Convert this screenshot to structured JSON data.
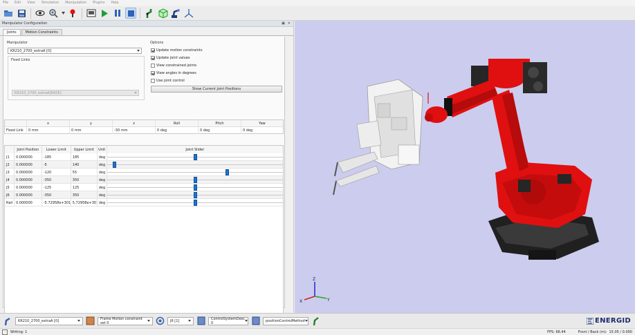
{
  "menu": [
    "File",
    "Edit",
    "View",
    "Simulation",
    "Manipulation",
    "Plugins",
    "Help"
  ],
  "panel": {
    "title": "Manipulator Configuration",
    "tabs": [
      "Joints",
      "Motion Constraints"
    ]
  },
  "manipulator": {
    "group_label": "Manipulator",
    "selected": "KR210_2700_extraA [0]",
    "fixed_links_label": "Fixed Links",
    "fixed_links_value": "KR210_2700_extraA[BASE]"
  },
  "options": {
    "group_label": "Options",
    "items": [
      {
        "label": "Update motion constraints",
        "checked": true
      },
      {
        "label": "Update joint values",
        "checked": true
      },
      {
        "label": "View constrained joints",
        "checked": false
      },
      {
        "label": "View angles in degrees",
        "checked": true
      },
      {
        "label": "Use joint control",
        "checked": false
      }
    ],
    "button": "Show Current Joint Positions"
  },
  "fixed_link_table": {
    "headers": [
      "",
      "x",
      "y",
      "z",
      "Roll",
      "Pitch",
      "Yaw"
    ],
    "row": [
      "Fixed Link",
      "0 mm",
      "0 mm",
      "-30 mm",
      "0 deg",
      "0 deg",
      "0 deg"
    ]
  },
  "joint_table": {
    "headers": [
      "",
      "Joint Position",
      "Lower Limit",
      "Upper Limit",
      "Unit",
      "Joint Slider"
    ],
    "rows": [
      {
        "name": "J1",
        "position": "0.000000",
        "lower": "-185",
        "upper": "185",
        "unit": "deg",
        "slider": 0.5
      },
      {
        "name": "J2",
        "position": "0.000000",
        "lower": "-5",
        "upper": "140",
        "unit": "deg",
        "slider": 0.034
      },
      {
        "name": "J3",
        "position": "0.000000",
        "lower": "-120",
        "upper": "55",
        "unit": "deg",
        "slider": 0.686
      },
      {
        "name": "J4",
        "position": "0.000000",
        "lower": "-350",
        "upper": "350",
        "unit": "deg",
        "slider": 0.5
      },
      {
        "name": "J5",
        "position": "0.000000",
        "lower": "-125",
        "upper": "125",
        "unit": "deg",
        "slider": 0.5
      },
      {
        "name": "J6",
        "position": "0.000000",
        "lower": "-350",
        "upper": "350",
        "unit": "deg",
        "slider": 0.5
      },
      {
        "name": "Rail",
        "position": "0.000000",
        "lower": "-5.72958e+301",
        "upper": "5.72958e+301",
        "unit": "deg",
        "slider": 0.5
      }
    ]
  },
  "bottom": {
    "manipulator": "KR210_2700_extraA [0]",
    "constraint_set": "Frame Motion constraint set 0",
    "joint": "J6 [1]",
    "control": "ControlSystemDesc 0",
    "method": "positionControlMethod",
    "brand": "ENERGID"
  },
  "status": {
    "left": "Writing: 1",
    "fps": "FPS: 66.44",
    "clip": "Front / Back (m):",
    "clip_value": "15.05 / 0.000"
  },
  "colors": {
    "robot_red": "#e01010",
    "viewport_bg": "#ccccee",
    "slider_blue": "#1f74d1"
  }
}
